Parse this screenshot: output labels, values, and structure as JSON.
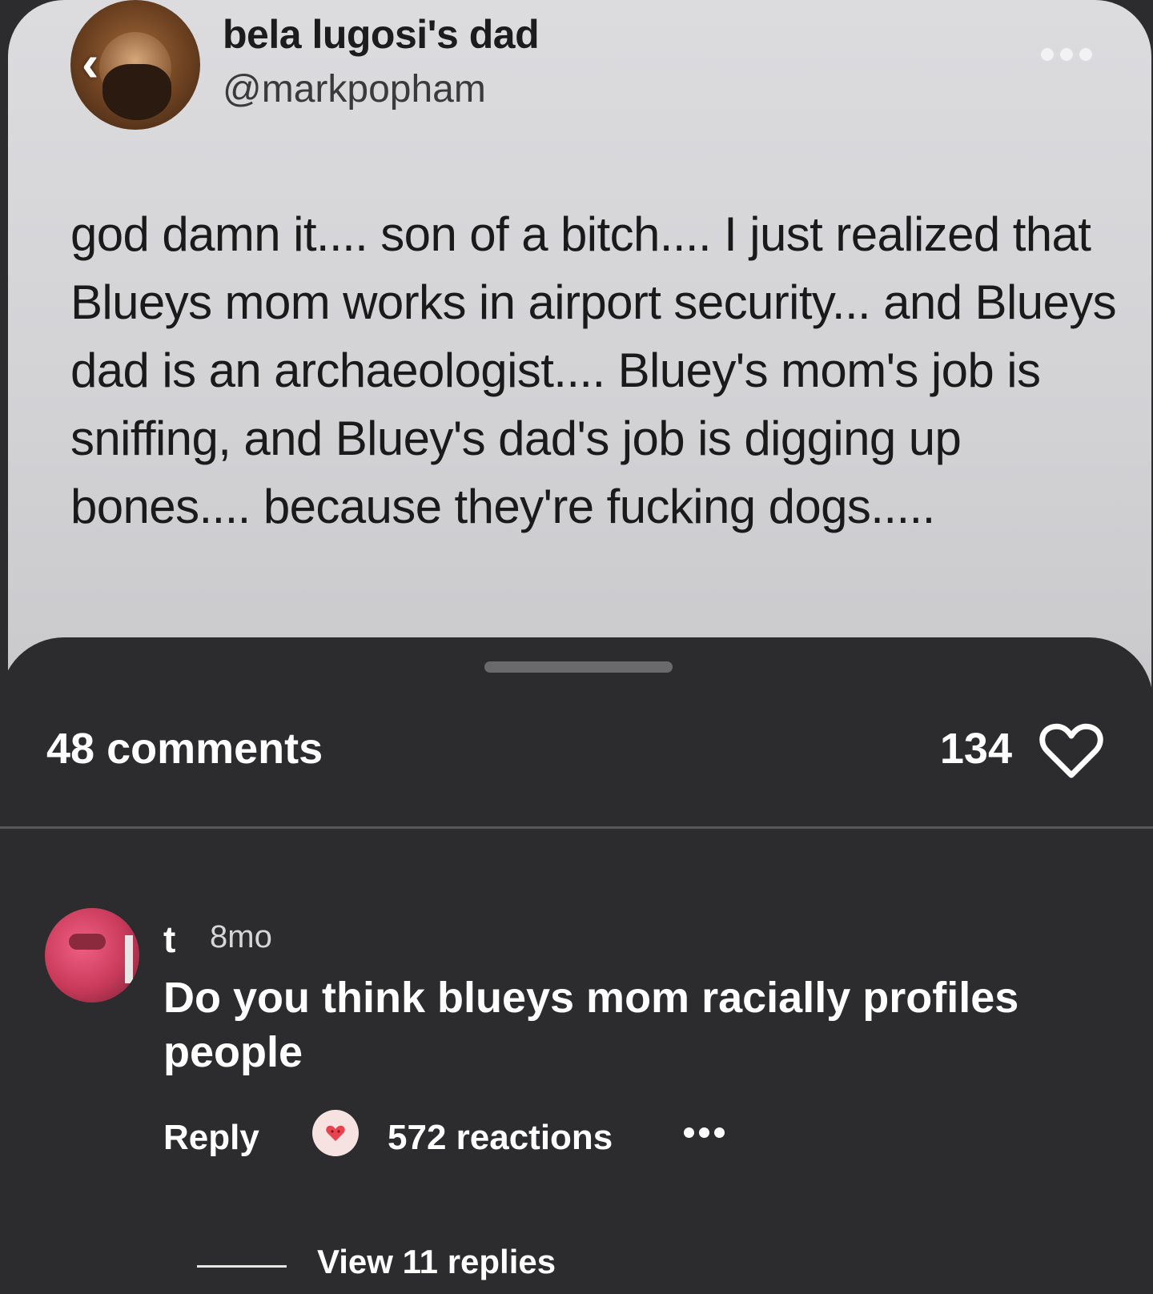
{
  "post": {
    "author_name": "bela lugosi's dad",
    "author_handle": "@markpopham",
    "text": "god damn it.... son of a bitch.... I just realized that Blueys mom works in airport security... and Blueys dad is an archaeologist.... Bluey's mom's job is sniffing, and Bluey's dad's job is digging up bones.... because they're fucking dogs....."
  },
  "sheet": {
    "comments_label": "48 comments",
    "likes_count": "134"
  },
  "comment": {
    "user": "t",
    "time": "8mo",
    "body": "Do you think blueys mom racially profiles people",
    "reply_label": "Reply",
    "reactions_label": "572 reactions",
    "view_replies_label": "View 11 replies"
  },
  "icons": {
    "back": "chevron-left-icon",
    "more": "more-horizontal-icon",
    "like": "heart-outline-icon",
    "reaction": "heart-reaction-icon"
  },
  "colors": {
    "post_bg": "#d6d6d9",
    "sheet_bg": "#2c2c2e",
    "text_light": "#ffffff",
    "text_dark": "#1a1a1a"
  }
}
